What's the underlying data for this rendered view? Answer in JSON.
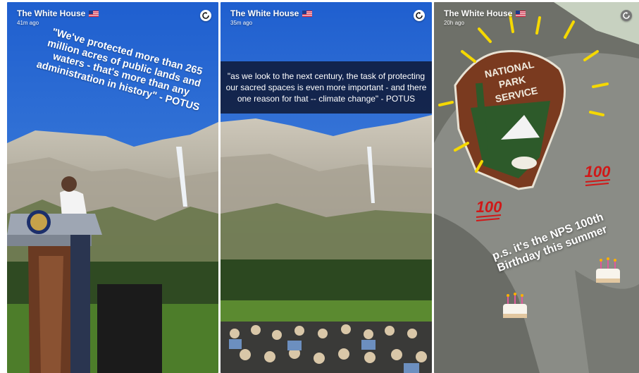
{
  "panels": [
    {
      "account": "The White House",
      "flag_icon": "us-flag-icon",
      "time": "41m ago",
      "quote": "\"We've protected more than 265 million acres of public lands and waters - that's more than any administration in history\" - POTUS"
    },
    {
      "account": "The White House",
      "flag_icon": "us-flag-icon",
      "time": "35m ago",
      "caption": "\"as we look to the next century, the task of protecting our sacred spaces is even more important - and there one reason for that -- climate change\" - POTUS"
    },
    {
      "account": "The White House",
      "flag_icon": "us-flag-icon",
      "time": "20h ago",
      "patch_line1": "NATIONAL",
      "patch_line2": "PARK",
      "patch_line3": "SERVICE",
      "sticker_text": "100",
      "caption": "p.s. it's the NPS 100th Birthday this summer"
    }
  ],
  "colors": {
    "sky": "#2f6fd0",
    "shirt": "#8a8c86",
    "patch_brown": "#7a3a1f",
    "stroke_yellow": "#f5d800",
    "emoji_red": "#d01818"
  }
}
